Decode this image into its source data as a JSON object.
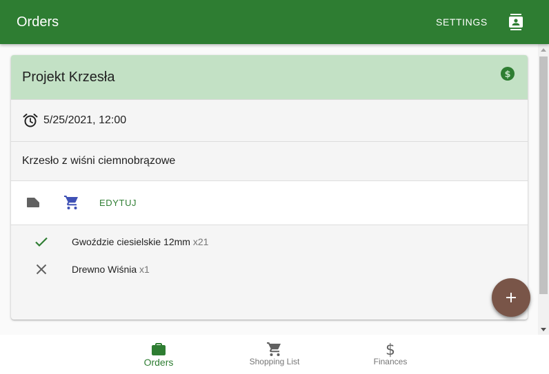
{
  "appbar": {
    "title": "Orders",
    "settings_label": "SETTINGS",
    "contact_icon": "contact-icon"
  },
  "order": {
    "title": "Projekt Krzesła",
    "date": "5/25/2021, 12:00",
    "description": "Krzesło z wiśni ciemnobrązowe",
    "edit_label": "EDYTUJ",
    "items": [
      {
        "name": "Gwoździe ciesielskie 12mm",
        "qty": "x21",
        "status": "done"
      },
      {
        "name": "Drewno Wiśnia",
        "qty": "x1",
        "status": "missing"
      }
    ]
  },
  "bottom_nav": {
    "items": [
      {
        "label": "Orders",
        "icon": "briefcase-icon",
        "active": true
      },
      {
        "label": "Shopping List",
        "icon": "cart-icon",
        "active": false
      },
      {
        "label": "Finances",
        "icon": "dollar-icon",
        "active": false
      }
    ]
  },
  "colors": {
    "primary": "#2e7d32",
    "card_header": "#c3e1c5",
    "fab": "#795548",
    "cart_icon": "#3f51b5",
    "muted_text": "#757575"
  }
}
